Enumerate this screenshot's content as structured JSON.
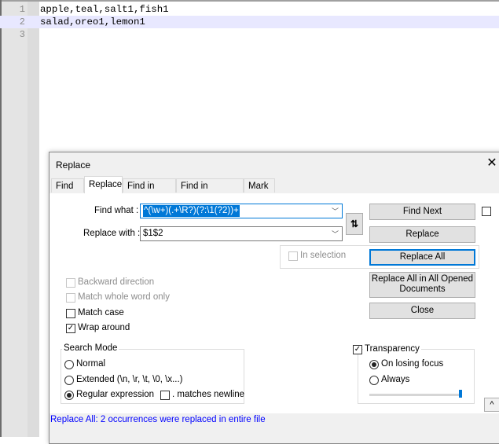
{
  "editor": {
    "lines": [
      {
        "number": "1",
        "text": "apple,teal,salt1,fish1"
      },
      {
        "number": "2",
        "text": "salad,oreo1,lemon1"
      },
      {
        "number": "3",
        "text": ""
      }
    ],
    "current_line": 2
  },
  "dialog": {
    "title": "Replace",
    "close_icon": "close-icon",
    "tabs": [
      {
        "label": "Find",
        "active": false
      },
      {
        "label": "Replace",
        "active": true
      },
      {
        "label": "Find in Files",
        "active": false
      },
      {
        "label": "Find in Projects",
        "active": false
      },
      {
        "label": "Mark",
        "active": false
      }
    ],
    "find_what": {
      "label": "Find what :",
      "value": "^(\\w+)(.+\\R?)(?:\\1(?2))+"
    },
    "replace_with": {
      "label": "Replace with :",
      "value": "$1$2"
    },
    "swap_icon": "swap-arrows-icon",
    "swap_glyph": "⇅",
    "buttons": {
      "find_next": "Find Next",
      "replace": "Replace",
      "replace_all": "Replace All",
      "replace_all_opened": "Replace All in All Opened Documents",
      "close": "Close"
    },
    "in_selection": {
      "label": "In selection",
      "checked": false,
      "enabled": false
    },
    "options": [
      {
        "label": "Backward direction",
        "checked": false,
        "enabled": false
      },
      {
        "label": "Match whole word only",
        "checked": false,
        "enabled": false
      },
      {
        "label": "Match case",
        "checked": false,
        "enabled": true
      },
      {
        "label": "Wrap around",
        "checked": true,
        "enabled": true
      }
    ],
    "search_mode": {
      "title": "Search Mode",
      "options": [
        {
          "label": "Normal",
          "selected": false
        },
        {
          "label": "Extended (\\n, \\r, \\t, \\0, \\x...)",
          "selected": false
        },
        {
          "label": "Regular expression",
          "selected": true
        }
      ],
      "dot_matches_newline": {
        "label": ". matches newline",
        "checked": false
      }
    },
    "transparency": {
      "label": "Transparency",
      "checked": true,
      "options": [
        {
          "label": "On losing focus",
          "selected": true
        },
        {
          "label": "Always",
          "selected": false
        }
      ],
      "level_percent": 100
    },
    "check_glyph": "✓",
    "collapse_glyph": "^",
    "chevron_glyph": "﹀",
    "close_glyph": "✕",
    "status": "Replace All: 2 occurrences were replaced in entire file"
  }
}
